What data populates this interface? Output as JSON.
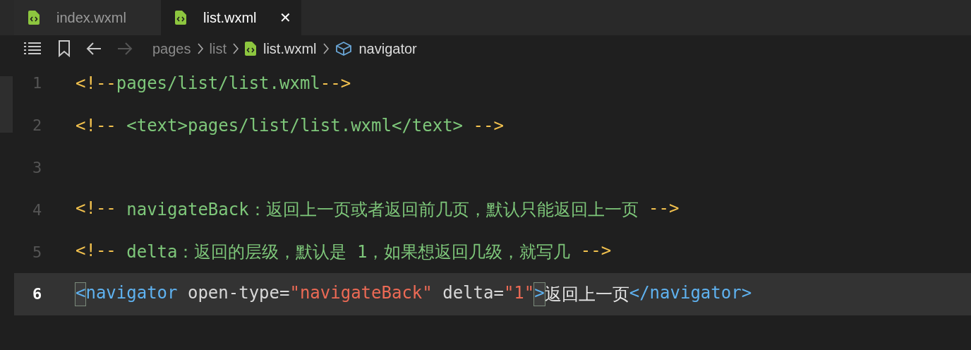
{
  "tabs": [
    {
      "label": "index.wxml",
      "selected": false
    },
    {
      "label": "list.wxml",
      "selected": true,
      "close": "✕"
    }
  ],
  "breadcrumb": [
    {
      "label": "pages",
      "kind": "folder"
    },
    {
      "label": "list",
      "kind": "folder"
    },
    {
      "label": "list.wxml",
      "kind": "file"
    },
    {
      "label": "navigator",
      "kind": "element"
    }
  ],
  "lines": [
    {
      "number": "1",
      "current": false,
      "tokens": [
        {
          "text": "<!--",
          "kind": "delim"
        },
        {
          "text": "pages/list/list.wxml",
          "kind": "comment"
        },
        {
          "text": "-->",
          "kind": "delim"
        }
      ]
    },
    {
      "number": "2",
      "current": false,
      "tokens": [
        {
          "text": "<!--",
          "kind": "delim"
        },
        {
          "text": " <text>pages/list/list.wxml</text> ",
          "kind": "comment"
        },
        {
          "text": "-->",
          "kind": "delim"
        }
      ]
    },
    {
      "number": "3",
      "current": false
    },
    {
      "number": "4",
      "current": false,
      "tokens": [
        {
          "text": "<!--",
          "kind": "delim"
        },
        {
          "text": " navigateBack：返回上一页或者返回前几页，默认只能返回上一页 ",
          "kind": "comment"
        },
        {
          "text": "-->",
          "kind": "delim"
        }
      ]
    },
    {
      "number": "5",
      "current": false,
      "tokens": [
        {
          "text": "<!--",
          "kind": "delim"
        },
        {
          "text": " delta：返回的层级，默认是 1，如果想返回几级，就写几 ",
          "kind": "comment"
        },
        {
          "text": "-->",
          "kind": "delim"
        }
      ]
    },
    {
      "number": "6",
      "current": true,
      "tokens": [
        {
          "text": "<",
          "kind": "tag",
          "matched": true
        },
        {
          "text": "navigator",
          "kind": "tag",
          "matched": false
        },
        {
          "text": " open-type=",
          "kind": "attr",
          "matched": false
        },
        {
          "text": "\"navigateBack\"",
          "kind": "string",
          "matched": false
        },
        {
          "text": " delta=",
          "kind": "attr",
          "matched": false
        },
        {
          "text": "\"1\"",
          "kind": "string",
          "matched": false
        },
        {
          "text": ">",
          "kind": "tag",
          "matched": true
        },
        {
          "text": "返回上一页",
          "kind": "text",
          "matched": false
        },
        {
          "text": "</navigator>",
          "kind": "tag",
          "matched": false
        }
      ]
    }
  ]
}
